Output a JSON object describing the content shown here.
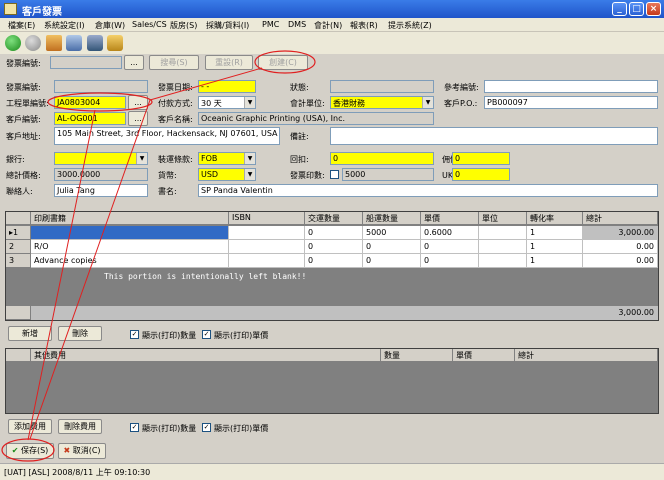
{
  "window": {
    "title": "客戶發票"
  },
  "menu": [
    "檔案(E)",
    "系統設定(I)",
    "倉庫(W)",
    "Sales/CS",
    "版房(S)",
    "採購/貨料(I)",
    "PMC",
    "DMS",
    "會計(N)",
    "報表(R)",
    "提示系統(Z)"
  ],
  "toolbar_icons": [
    "back-icon",
    "forward-icon",
    "home-icon",
    "settings-icon",
    "user-icon",
    "lock-icon"
  ],
  "search": {
    "label": "發票編號:",
    "browse_label": "...",
    "search_button": "搜尋(S)",
    "reset_button": "重設(R)",
    "create_button": "創建(C)"
  },
  "form": {
    "invoice_no_label": "發票編號:",
    "invoice_no": "",
    "invoice_date_label": "發票日期:",
    "invoice_date": "- -",
    "status_label": "狀態:",
    "status": "",
    "ref_no_label": "參考編號:",
    "ref_no": "",
    "job_no_label": "工程單編號:",
    "job_no": "JA0803004",
    "payment_label": "付款方式:",
    "payment": "30 天",
    "account_unit_label": "會計單位:",
    "account_unit": "香港財務",
    "customer_po_label": "客戶P.O.:",
    "customer_po": "PB000097",
    "customer_no_label": "客戶編號:",
    "customer_no": "AL-OG001",
    "customer_name_label": "客戶名稱:",
    "customer_name": "Oceanic Graphic Printing (USA), Inc.",
    "customer_address_label": "客戶地址:",
    "customer_address": "105 Main Street, 3rd Floor, Hackensack, NJ 07601, USA",
    "remarks_label": "備註:",
    "remarks": "",
    "bank_label": "銀行:",
    "bank": "",
    "shipping_terms_label": "裝運條款:",
    "shipping_terms": "FOB",
    "discount_label": "回扣:",
    "discount": "0",
    "commission_label": "佣價佣金:",
    "commission": "0",
    "total_price_label": "總計價格:",
    "total_price": "3000.0000",
    "currency_label": "貨幣:",
    "currency": "USD",
    "invoice_copies_label": "發票印數:",
    "invoice_copies": "5000",
    "uk_commission_label": "UK佣金:",
    "uk_commission": "0",
    "contact_label": "聯絡人:",
    "contact": "Julia Tang",
    "book_name_label": "書名:",
    "book_name": "SP Panda Valentin"
  },
  "items_table": {
    "columns": [
      "印刷書籍",
      "ISBN",
      "交運數量",
      "船運數量",
      "單價",
      "單位",
      "轉化率",
      "總計"
    ],
    "rows": [
      {
        "no": "1",
        "cells": [
          "",
          "",
          "0",
          "5000",
          "0.6000",
          "",
          "1",
          "3,000.00"
        ]
      },
      {
        "no": "2",
        "cells": [
          "R/O",
          "",
          "0",
          "0",
          "0",
          "",
          "1",
          "0.00"
        ]
      },
      {
        "no": "3",
        "cells": [
          "Advance copies",
          "",
          "0",
          "0",
          "0",
          "",
          "1",
          "0.00"
        ]
      }
    ],
    "blank_note": "This portion is intentionally left blank!!",
    "total": "3,000.00"
  },
  "items_actions": {
    "add": "新增",
    "delete": "刪除",
    "show_qty": "顯示(打印)數量",
    "show_price": "顯示(打印)單價"
  },
  "other_table": {
    "columns": [
      "其他費用",
      "數量",
      "單價",
      "總計"
    ]
  },
  "other_actions": {
    "add": "添加費用",
    "delete": "刪除費用",
    "show_qty": "顯示(打印)數量",
    "show_price": "顯示(打印)單價"
  },
  "footer": {
    "save": "保存(S)",
    "cancel": "取消(C)"
  },
  "status": "[UAT] [ASL] 2008/8/11 上午 09:10:30"
}
